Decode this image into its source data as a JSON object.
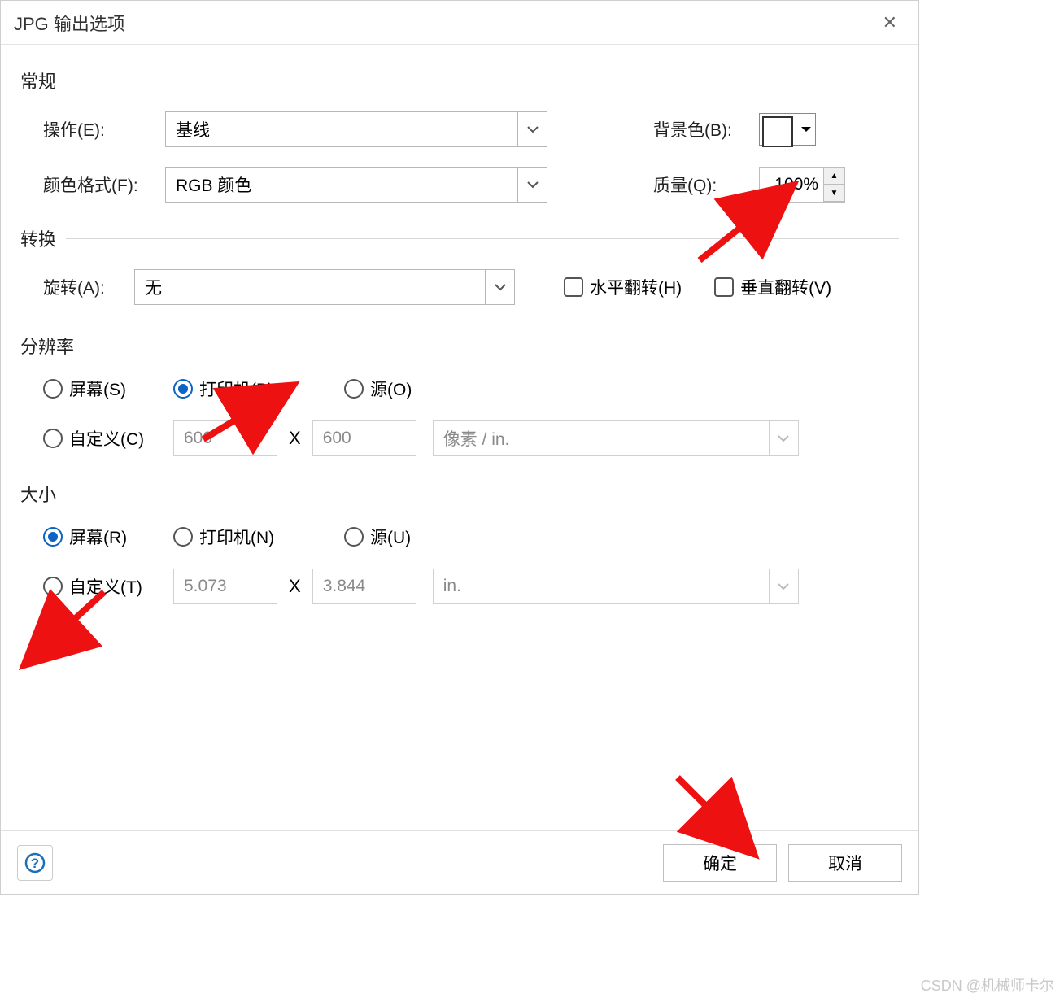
{
  "title": "JPG 输出选项",
  "groups": {
    "general": "常规",
    "transform": "转换",
    "resolution": "分辨率",
    "size": "大小"
  },
  "general": {
    "operation_label": "操作(E):",
    "operation_value": "基线",
    "color_format_label": "颜色格式(F):",
    "color_format_value": "RGB 颜色",
    "bg_label": "背景色(B):",
    "quality_label": "质量(Q):",
    "quality_value": "100%"
  },
  "transform": {
    "rotate_label": "旋转(A):",
    "rotate_value": "无",
    "flip_h": "水平翻转(H)",
    "flip_v": "垂直翻转(V)"
  },
  "resolution": {
    "screen": "屏幕(S)",
    "printer": "打印机(P)",
    "source": "源(O)",
    "custom": "自定义(C)",
    "width": "600",
    "height": "600",
    "unit": "像素 / in."
  },
  "size": {
    "screen": "屏幕(R)",
    "printer": "打印机(N)",
    "source": "源(U)",
    "custom": "自定义(T)",
    "width": "5.073",
    "height": "3.844",
    "unit": "in."
  },
  "buttons": {
    "ok": "确定",
    "cancel": "取消"
  },
  "watermark": "CSDN @机械师卡尔",
  "x_sep": "X"
}
